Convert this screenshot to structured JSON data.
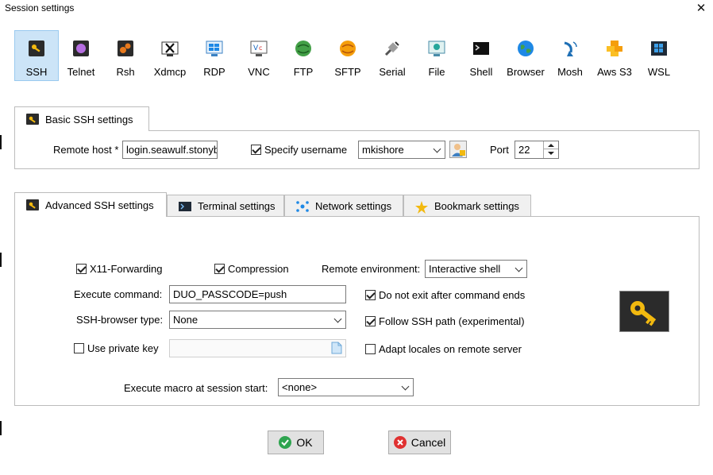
{
  "window": {
    "title": "Session settings",
    "close_glyph": "✕"
  },
  "protocols": [
    {
      "label": "SSH",
      "icon": "ssh-key-icon",
      "active": true
    },
    {
      "label": "Telnet",
      "icon": "telnet-icon"
    },
    {
      "label": "Rsh",
      "icon": "rsh-icon"
    },
    {
      "label": "Xdmcp",
      "icon": "xdmcp-icon"
    },
    {
      "label": "RDP",
      "icon": "rdp-icon"
    },
    {
      "label": "VNC",
      "icon": "vnc-icon"
    },
    {
      "label": "FTP",
      "icon": "ftp-icon"
    },
    {
      "label": "SFTP",
      "icon": "sftp-icon"
    },
    {
      "label": "Serial",
      "icon": "serial-icon"
    },
    {
      "label": "File",
      "icon": "file-icon"
    },
    {
      "label": "Shell",
      "icon": "shell-icon"
    },
    {
      "label": "Browser",
      "icon": "browser-globe-icon"
    },
    {
      "label": "Mosh",
      "icon": "mosh-antenna-icon"
    },
    {
      "label": "Aws S3",
      "icon": "aws-s3-icon"
    },
    {
      "label": "WSL",
      "icon": "wsl-windows-icon"
    }
  ],
  "basic": {
    "tab_label": "Basic SSH settings",
    "remote_host_label": "Remote host *",
    "remote_host_value": "login.seawulf.stonyb",
    "specify_username_label": "Specify username",
    "specify_username_checked": true,
    "username_value": "mkishore",
    "port_label": "Port",
    "port_value": "22"
  },
  "tabs": [
    {
      "label": "Advanced SSH settings",
      "icon": "wrench-key-icon",
      "selected": true
    },
    {
      "label": "Terminal settings",
      "icon": "terminal-icon"
    },
    {
      "label": "Network settings",
      "icon": "network-icon"
    },
    {
      "label": "Bookmark settings",
      "icon": "star-icon"
    }
  ],
  "advanced": {
    "x11_label": "X11-Forwarding",
    "compression_label": "Compression",
    "remote_env_label": "Remote environment:",
    "remote_env_value": "Interactive shell",
    "execute_command_label": "Execute command:",
    "execute_command_value": "DUO_PASSCODE=push",
    "do_not_exit_label": "Do not exit after command ends",
    "ssh_browser_label": "SSH-browser type:",
    "ssh_browser_value": "None",
    "follow_ssh_label": "Follow SSH path (experimental)",
    "private_key_label": "Use private key",
    "adapt_locales_label": "Adapt locales on remote server",
    "macro_label": "Execute macro at session start:",
    "macro_value": "<none>"
  },
  "buttons": {
    "ok": "OK",
    "cancel": "Cancel"
  },
  "colors": {
    "active_bg": "#cce4f7",
    "key_gold": "#f2b90f",
    "ok_green": "#2ea44f",
    "cancel_red": "#e03131"
  }
}
